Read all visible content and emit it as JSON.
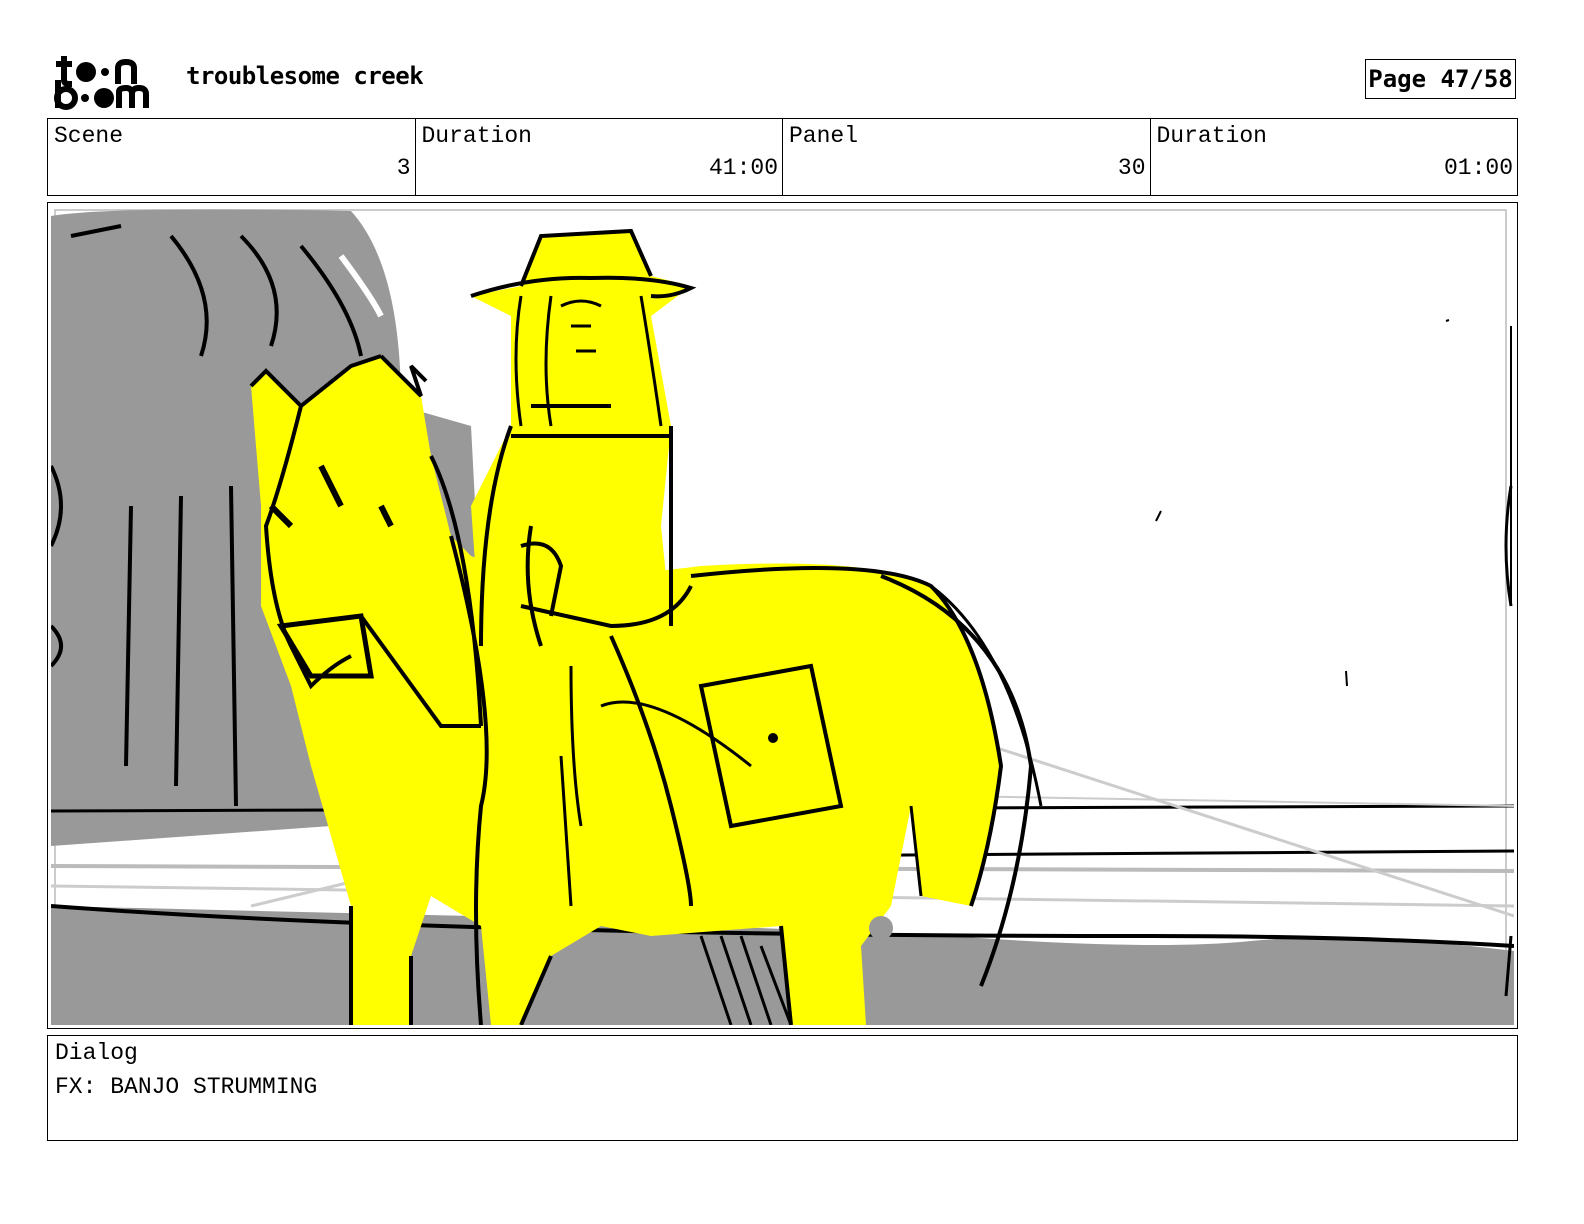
{
  "header": {
    "logo_top": "to•n",
    "logo_bottom": "b••m",
    "project_title": "troublesome creek",
    "page_label": "Page 47/58"
  },
  "info": {
    "scene_label": "Scene",
    "scene_value": "3",
    "scene_duration_label": "Duration",
    "scene_duration_value": "41:00",
    "panel_label": "Panel",
    "panel_value": "30",
    "panel_duration_label": "Duration",
    "panel_duration_value": "01:00"
  },
  "dialog": {
    "label": "Dialog",
    "text": "FX: BANJO STRUMMING"
  },
  "colors": {
    "highlight": "#ffff00",
    "shadow_gray": "#999999",
    "line": "#000000"
  }
}
